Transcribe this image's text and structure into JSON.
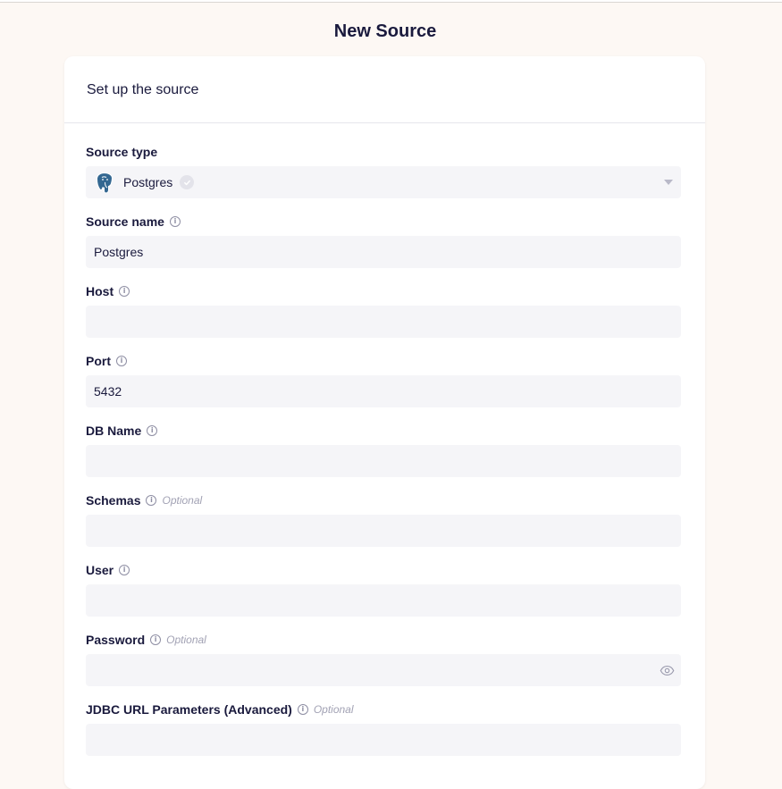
{
  "page": {
    "title": "New Source"
  },
  "card": {
    "header": "Set up the source"
  },
  "fields": {
    "source_type": {
      "label": "Source type",
      "value": "Postgres",
      "icon": "postgres-elephant-logo"
    },
    "source_name": {
      "label": "Source name",
      "value": "Postgres"
    },
    "host": {
      "label": "Host",
      "value": ""
    },
    "port": {
      "label": "Port",
      "value": "5432"
    },
    "db_name": {
      "label": "DB Name",
      "value": ""
    },
    "schemas": {
      "label": "Schemas",
      "optional": "Optional",
      "value": ""
    },
    "user": {
      "label": "User",
      "value": ""
    },
    "password": {
      "label": "Password",
      "optional": "Optional",
      "value": ""
    },
    "jdbc": {
      "label": "JDBC URL Parameters (Advanced)",
      "optional": "Optional",
      "value": ""
    }
  },
  "colors": {
    "background": "#fdf8f4",
    "input_bg": "#f5f5f8",
    "text": "#1a1a3d",
    "muted": "#a2a2b4"
  }
}
